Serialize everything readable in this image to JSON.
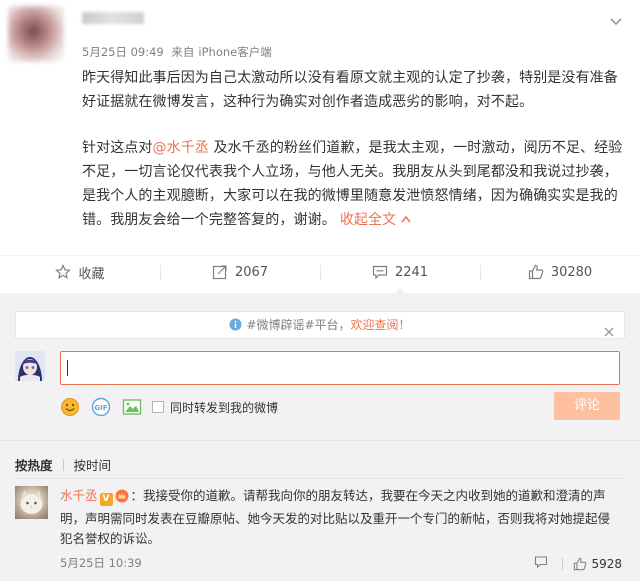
{
  "post": {
    "timestamp": "5月25日 09:49",
    "source_prefix": "来自",
    "source": "iPhone客户端",
    "paragraph1": "昨天得知此事后因为自己太激动所以没有看原文就主观的认定了抄袭，特别是没有准备好证据就在微博发言，这种行为确实对创作者造成恶劣的影响，对不起。",
    "p2_part1": "针对这点对",
    "p2_mention": "@水千丞",
    "p2_part2": " 及水千丞的粉丝们道歉，是我太主观，一时激动，阅历不足、经验不足，一切言论仅代表我个人立场，与他人无关。我朋友从头到尾都没和我说过抄袭，是我个人的主观臆断，大家可以在我的微博里随意发泄愤怒情绪，因为确确实实是我的错。我朋友会给一个完整答复的，谢谢。",
    "collapse_label": "收起全文"
  },
  "actions": {
    "favorite": "收藏",
    "repost": "2067",
    "comment": "2241",
    "like": "30280"
  },
  "comment_box": {
    "rumor_tag": "#微博辟谣#平台，",
    "rumor_link": "欢迎查阅！",
    "forward_label": "同时转发到我的微博",
    "submit_label": "评论"
  },
  "sort": {
    "hot": "按热度",
    "time": "按时间"
  },
  "comment": {
    "author": "水千丞",
    "text": "：我接受你的道歉。请帮我向你的朋友转达，我要在今天之内收到她的道歉和澄清的声明，声明需同时发表在豆瓣原帖、她今天发的对比贴以及重开一个专门的新帖，否则我将对她提起侵犯名誉权的诉讼。",
    "time": "5月25日 10:39",
    "likes": "5928"
  },
  "colors": {
    "accent": "#eb7350",
    "submit_disabled": "#ffc09f",
    "panel_bg": "#f2f2f5"
  },
  "icons": [
    "chevron-down-icon",
    "star-icon",
    "repost-icon",
    "comment-icon",
    "like-icon",
    "info-icon",
    "close-icon",
    "emoji-icon",
    "gif-icon",
    "image-icon",
    "crown-badge-icon",
    "reply-icon"
  ]
}
